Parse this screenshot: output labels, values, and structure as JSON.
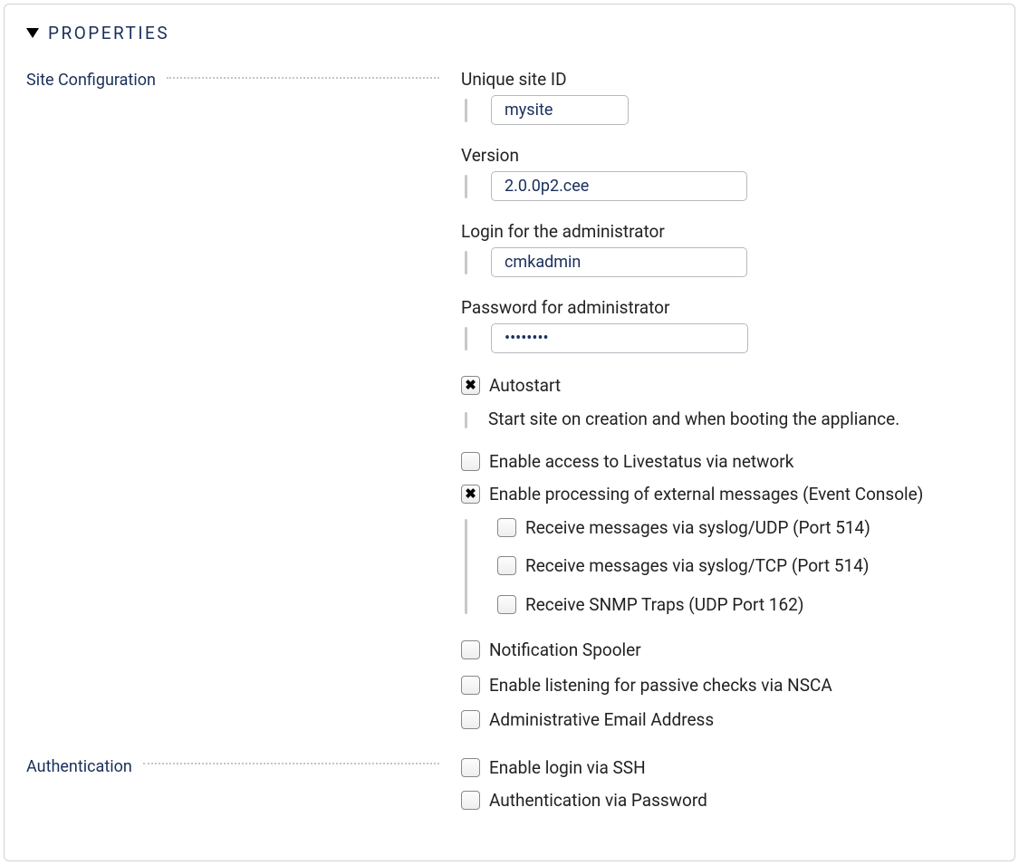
{
  "panel": {
    "title": "Properties"
  },
  "sections": {
    "siteConfig": {
      "label": "Site Configuration",
      "fields": {
        "siteId": {
          "label": "Unique site ID",
          "value": "mysite"
        },
        "version": {
          "label": "Version",
          "value": "2.0.0p2.cee"
        },
        "adminLogin": {
          "label": "Login for the administrator",
          "value": "cmkadmin"
        },
        "adminPassword": {
          "label": "Password for administrator",
          "value": "••••••••"
        },
        "autostart": {
          "label": "Autostart",
          "description": "Start site on creation and when booting the appliance.",
          "checked": true
        },
        "livestatus": {
          "label": "Enable access to Livestatus via network",
          "checked": false
        },
        "eventConsole": {
          "label": "Enable processing of external messages (Event Console)",
          "checked": true,
          "children": {
            "syslogUdp": {
              "label": "Receive messages via syslog/UDP (Port 514)",
              "checked": false
            },
            "syslogTcp": {
              "label": "Receive messages via syslog/TCP (Port 514)",
              "checked": false
            },
            "snmpTraps": {
              "label": "Receive SNMP Traps (UDP Port 162)",
              "checked": false
            }
          }
        },
        "notificationSpooler": {
          "label": "Notification Spooler",
          "checked": false
        },
        "nsca": {
          "label": "Enable listening for passive checks via NSCA",
          "checked": false
        },
        "adminEmail": {
          "label": "Administrative Email Address",
          "checked": false
        }
      }
    },
    "authentication": {
      "label": "Authentication",
      "fields": {
        "ssh": {
          "label": "Enable login via SSH",
          "checked": false
        },
        "password": {
          "label": "Authentication via Password",
          "checked": false
        }
      }
    }
  }
}
